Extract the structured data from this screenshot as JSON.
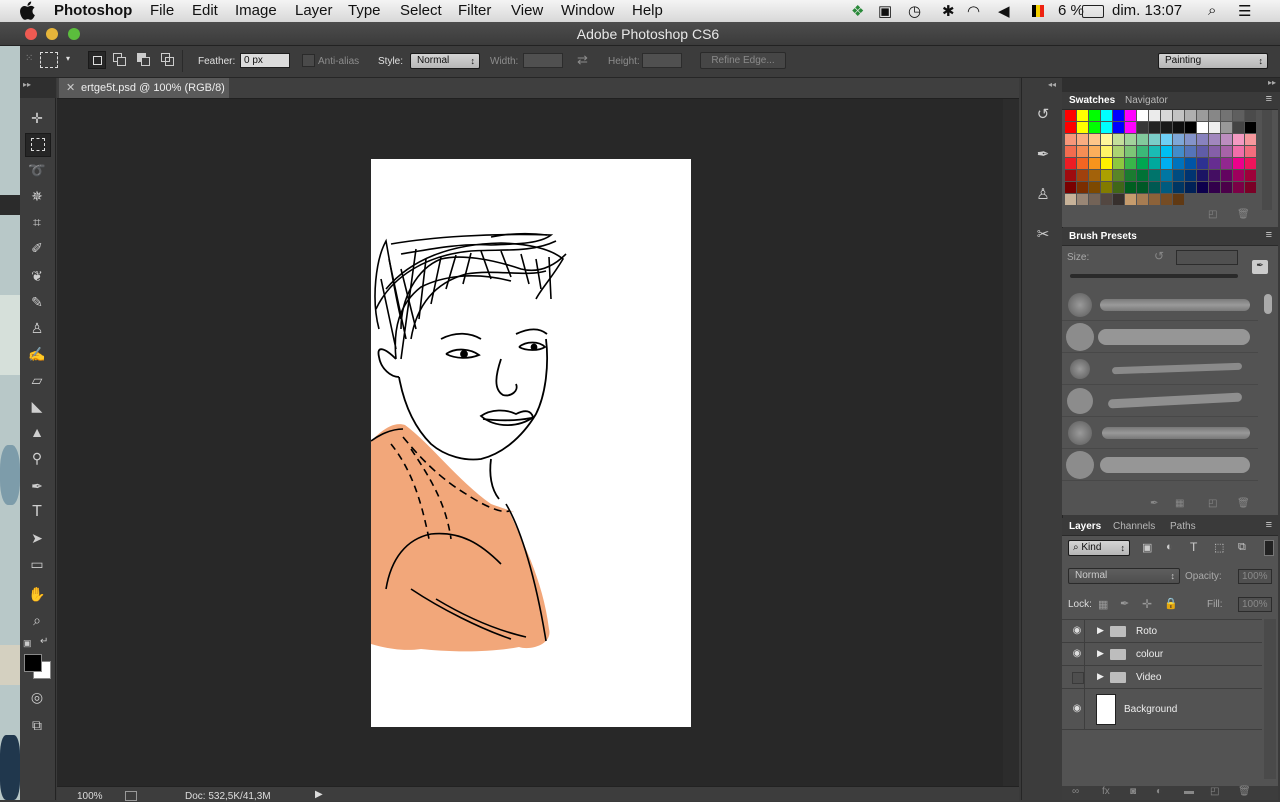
{
  "menubar": {
    "app": "Photoshop",
    "items": [
      "File",
      "Edit",
      "Image",
      "Layer",
      "Type",
      "Select",
      "Filter",
      "View",
      "Window",
      "Help"
    ],
    "status": {
      "battery": "6 %",
      "clock": "dim. 13:07"
    }
  },
  "window": {
    "title": "Adobe Photoshop CS6"
  },
  "options": {
    "feather_label": "Feather:",
    "feather_value": "0 px",
    "antialias_label": "Anti-alias",
    "style_label": "Style:",
    "style_value": "Normal",
    "width_label": "Width:",
    "height_label": "Height:",
    "refine_label": "Refine Edge...",
    "workspace_value": "Painting"
  },
  "document": {
    "tab_label": "ertge5t.psd @ 100% (RGB/8)",
    "zoom": "100%",
    "doc_info": "Doc: 532,5K/41,3M"
  },
  "swatches_panel": {
    "tabs": [
      "Swatches",
      "Navigator"
    ],
    "colors": [
      [
        "#ff0000",
        "#ffff00",
        "#00ff00",
        "#00ffff",
        "#0000ff",
        "#ff00ff",
        "#ffffff",
        "#ebebeb",
        "#d7d7d7",
        "#c3c3c3",
        "#afafaf",
        "#9b9b9b",
        "#878787",
        "#737373",
        "#5f5f5f",
        "#4b4b4b"
      ],
      [
        "#ff0000",
        "#ffff00",
        "#00ff00",
        "#00ffff",
        "#0000ff",
        "#ff00ff",
        "#373737",
        "#232323",
        "#191919",
        "#0f0f0f",
        "#000000",
        "#ffffff",
        "#eeeeee",
        "#999999",
        "#444444",
        "#000000"
      ],
      [
        "#f7977a",
        "#f9ad81",
        "#fdc68a",
        "#fff79a",
        "#c4df9b",
        "#a2d39c",
        "#82ca9d",
        "#7bcdc8",
        "#6ecff6",
        "#7ea7d8",
        "#8493ca",
        "#8882be",
        "#a187be",
        "#bc8dbf",
        "#f49ac2",
        "#f6989d"
      ],
      [
        "#f26c4f",
        "#f68e55",
        "#fbaf5c",
        "#fff467",
        "#acd372",
        "#7cc576",
        "#3bb878",
        "#1abbb4",
        "#00bff3",
        "#438cca",
        "#5574b9",
        "#605ca8",
        "#855fa8",
        "#a763a8",
        "#f06ea9",
        "#f26d7d"
      ],
      [
        "#ed1c24",
        "#f26522",
        "#f7941d",
        "#fff200",
        "#8dc73f",
        "#39b54a",
        "#00a651",
        "#00a99d",
        "#00aeef",
        "#0072bc",
        "#0054a6",
        "#2e3192",
        "#662d91",
        "#92278f",
        "#ec008c",
        "#ed145b"
      ],
      [
        "#9e0b0f",
        "#a0410d",
        "#a3620a",
        "#aba000",
        "#598527",
        "#1a7b30",
        "#007236",
        "#00746b",
        "#0076a3",
        "#004b80",
        "#003471",
        "#1b1464",
        "#440e62",
        "#630460",
        "#9e005d",
        "#9e0039"
      ],
      [
        "#790000",
        "#7b2e00",
        "#7d4900",
        "#827b00",
        "#406618",
        "#005e20",
        "#005826",
        "#005952",
        "#005b7f",
        "#003663",
        "#002157",
        "#0d004c",
        "#32004b",
        "#4b0049",
        "#7b0046",
        "#7a0026"
      ],
      [
        "#c7b299",
        "#998675",
        "#736357",
        "#534741",
        "#37302d",
        "#c69c6d",
        "#a67c52",
        "#8c6239",
        "#754c24",
        "#603913",
        "",
        "",
        "",
        "",
        "",
        ""
      ]
    ]
  },
  "brush_panel": {
    "title": "Brush Presets",
    "size_label": "Size:"
  },
  "layers_panel": {
    "tabs": [
      "Layers",
      "Channels",
      "Paths"
    ],
    "kind_label": "Kind",
    "blend_mode": "Normal",
    "opacity_label": "Opacity:",
    "opacity_value": "100%",
    "lock_label": "Lock:",
    "fill_label": "Fill:",
    "fill_value": "100%",
    "layers": [
      {
        "name": "Roto",
        "visible": true
      },
      {
        "name": "colour",
        "visible": true
      },
      {
        "name": "Video",
        "visible": false
      },
      {
        "name": "Background",
        "visible": true
      }
    ]
  },
  "colors": {
    "canvas_bg": "#282828",
    "skin_fill": "#f2a77a"
  }
}
